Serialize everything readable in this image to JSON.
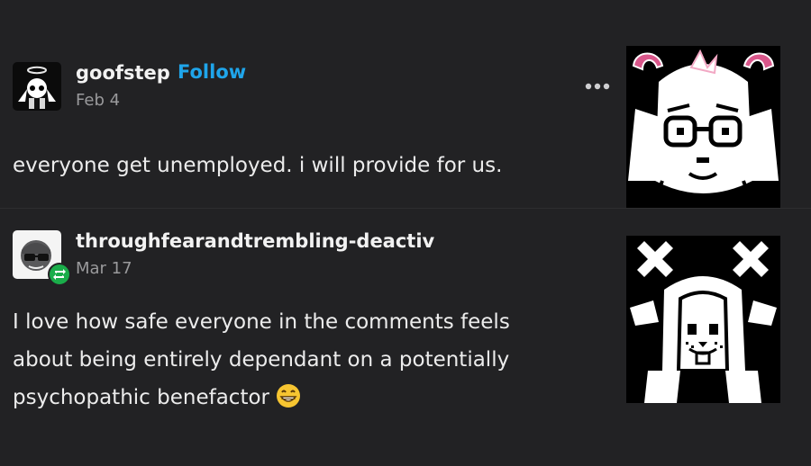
{
  "posts": [
    {
      "username": "goofstep",
      "follow_label": "Follow",
      "date": "Feb 4",
      "text": "everyone get unemployed. i will provide for us.",
      "avatar_icon": "angel-character-icon",
      "more_icon": "more-options-icon"
    },
    {
      "username": "throughfearandtrembling-deactiv",
      "date": "Mar 17",
      "lines": [
        "I love how safe everyone in the comments feels",
        "about being entirely dependant on a potentially",
        "psychopathic benefactor"
      ],
      "emoji": "grinning-face-emoji",
      "avatar_icon": "sunglasses-face-icon",
      "badge_icon": "reblog-icon"
    }
  ],
  "colors": {
    "background": "#222224",
    "follow": "#1fa5ea",
    "reblog_badge": "#1aad4a",
    "horn_pink": "#d9568a"
  }
}
